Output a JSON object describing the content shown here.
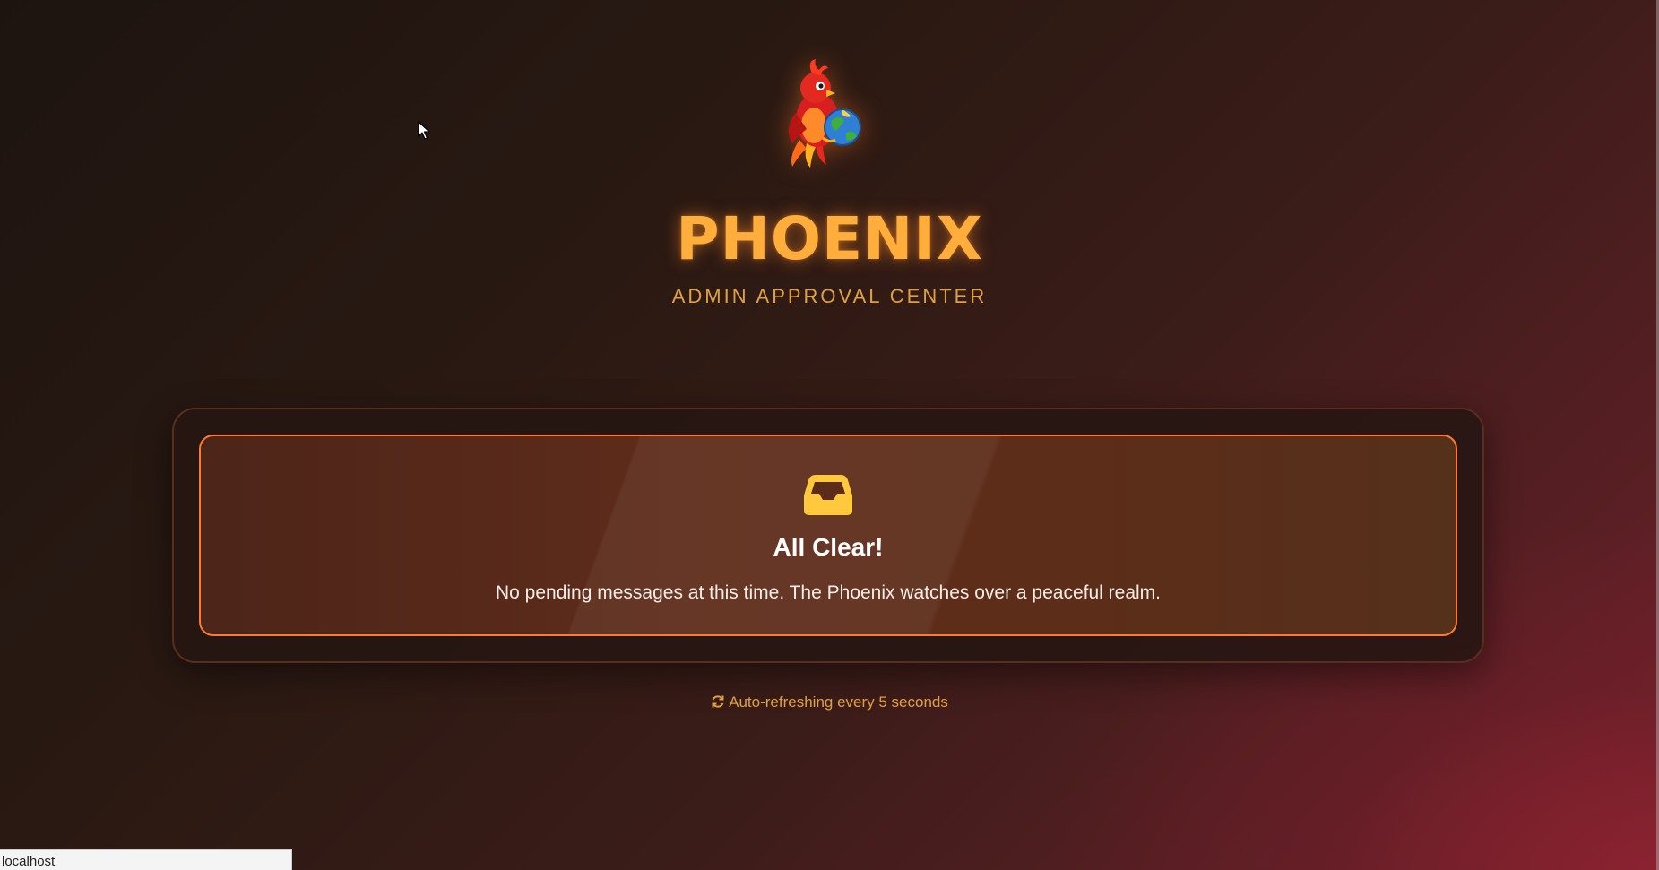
{
  "header": {
    "logo_alt": "Phoenix logo",
    "title": "PHOENIX",
    "subtitle": "ADMIN APPROVAL CENTER"
  },
  "empty_state": {
    "icon": "inbox-icon",
    "heading": "All Clear!",
    "message": "No pending messages at this time. The Phoenix watches over a peaceful realm."
  },
  "footer": {
    "refresh_icon": "refresh-icon",
    "refresh_text": "Auto-refreshing every 5 seconds"
  },
  "browser": {
    "status_url": "localhost"
  },
  "colors": {
    "accent": "#ffad3b",
    "subtitle": "#e0a042",
    "card_border": "#ff7a2e",
    "icon": "#ffc83d"
  }
}
